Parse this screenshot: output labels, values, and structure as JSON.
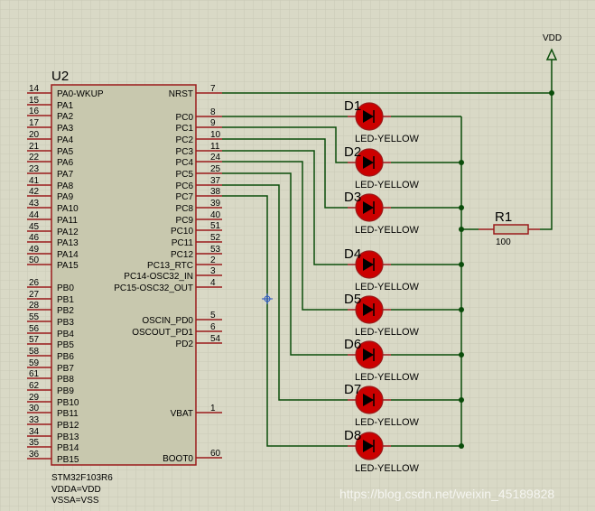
{
  "chip": {
    "ref": "U2",
    "part": "STM32F103R6",
    "notes": [
      "VDDA=VDD",
      "VSSA=VSS"
    ],
    "left_pins": [
      {
        "num": "14",
        "name": "PA0-WKUP"
      },
      {
        "num": "15",
        "name": "PA1"
      },
      {
        "num": "16",
        "name": "PA2"
      },
      {
        "num": "17",
        "name": "PA3"
      },
      {
        "num": "20",
        "name": "PA4"
      },
      {
        "num": "21",
        "name": "PA5"
      },
      {
        "num": "22",
        "name": "PA6"
      },
      {
        "num": "23",
        "name": "PA7"
      },
      {
        "num": "41",
        "name": "PA8"
      },
      {
        "num": "42",
        "name": "PA9"
      },
      {
        "num": "43",
        "name": "PA10"
      },
      {
        "num": "44",
        "name": "PA11"
      },
      {
        "num": "45",
        "name": "PA12"
      },
      {
        "num": "46",
        "name": "PA13"
      },
      {
        "num": "49",
        "name": "PA14"
      },
      {
        "num": "50",
        "name": "PA15"
      },
      {
        "num": "26",
        "name": "PB0"
      },
      {
        "num": "27",
        "name": "PB1"
      },
      {
        "num": "28",
        "name": "PB2"
      },
      {
        "num": "55",
        "name": "PB3"
      },
      {
        "num": "56",
        "name": "PB4"
      },
      {
        "num": "57",
        "name": "PB5"
      },
      {
        "num": "58",
        "name": "PB6"
      },
      {
        "num": "59",
        "name": "PB7"
      },
      {
        "num": "61",
        "name": "PB8"
      },
      {
        "num": "62",
        "name": "PB9"
      },
      {
        "num": "29",
        "name": "PB10"
      },
      {
        "num": "30",
        "name": "PB11"
      },
      {
        "num": "33",
        "name": "PB12"
      },
      {
        "num": "34",
        "name": "PB13"
      },
      {
        "num": "35",
        "name": "PB14"
      },
      {
        "num": "36",
        "name": "PB15"
      }
    ],
    "right_pins": [
      {
        "num": "7",
        "name": "NRST"
      },
      {
        "num": "8",
        "name": "PC0"
      },
      {
        "num": "9",
        "name": "PC1"
      },
      {
        "num": "10",
        "name": "PC2"
      },
      {
        "num": "11",
        "name": "PC3"
      },
      {
        "num": "24",
        "name": "PC4"
      },
      {
        "num": "25",
        "name": "PC5"
      },
      {
        "num": "37",
        "name": "PC6"
      },
      {
        "num": "38",
        "name": "PC7"
      },
      {
        "num": "39",
        "name": "PC8"
      },
      {
        "num": "40",
        "name": "PC9"
      },
      {
        "num": "51",
        "name": "PC10"
      },
      {
        "num": "52",
        "name": "PC11"
      },
      {
        "num": "53",
        "name": "PC12"
      },
      {
        "num": "2",
        "name": "PC13_RTC"
      },
      {
        "num": "3",
        "name": "PC14-OSC32_IN"
      },
      {
        "num": "4",
        "name": "PC15-OSC32_OUT"
      },
      {
        "num": "5",
        "name": "OSCIN_PD0"
      },
      {
        "num": "6",
        "name": "OSCOUT_PD1"
      },
      {
        "num": "54",
        "name": "PD2"
      },
      {
        "num": "1",
        "name": "VBAT"
      },
      {
        "num": "60",
        "name": "BOOT0"
      }
    ]
  },
  "leds": [
    {
      "ref": "D1",
      "part": "LED-YELLOW"
    },
    {
      "ref": "D2",
      "part": "LED-YELLOW"
    },
    {
      "ref": "D3",
      "part": "LED-YELLOW"
    },
    {
      "ref": "D4",
      "part": "LED-YELLOW"
    },
    {
      "ref": "D5",
      "part": "LED-YELLOW"
    },
    {
      "ref": "D6",
      "part": "LED-YELLOW"
    },
    {
      "ref": "D7",
      "part": "LED-YELLOW"
    },
    {
      "ref": "D8",
      "part": "LED-YELLOW"
    }
  ],
  "resistor": {
    "ref": "R1",
    "value": "100"
  },
  "power": {
    "label": "VDD"
  },
  "watermark": "https://blog.csdn.net/weixin_45189828",
  "colors": {
    "background": "#d9d9c6",
    "grid": "#c9c9b6",
    "chip_fill": "#c8c8ae",
    "component": "#9b1b1b",
    "led_fill": "#cc0000",
    "wire": "#0a4d0a",
    "text": "#000000"
  }
}
